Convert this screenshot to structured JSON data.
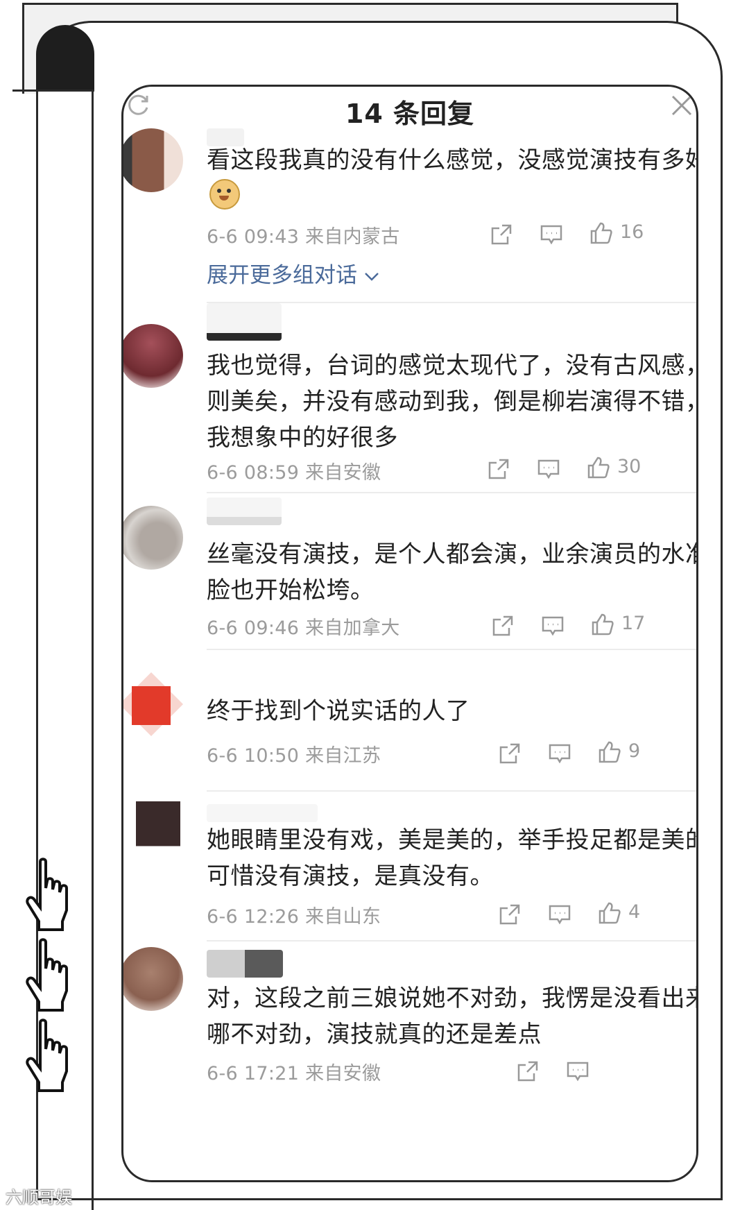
{
  "header": {
    "title": "14 条回复"
  },
  "comments": [
    {
      "text": "看这段我真的没有什么感觉，没感觉演技有多好",
      "meta": "6-6 09:43 来自内蒙古",
      "likes": "16",
      "avatar_color": "#8a5a48"
    },
    {
      "text": "我也觉得，台词的感觉太现代了，没有古风感，美则美矣，并没有感动到我，倒是柳岩演得不错，比我想象中的好很多",
      "meta": "6-6 08:59 来自安徽",
      "likes": "30",
      "avatar_color": "#6e2a30"
    },
    {
      "text": "丝毫没有演技，是个人都会演，业余演员的水准，脸也开始松垮。",
      "meta": "6-6 09:46 来自加拿大",
      "likes": "17",
      "avatar_color": "#a49c96"
    },
    {
      "text": "终于找到个说实话的人了",
      "meta": "6-6 10:50 来自江苏",
      "likes": "9",
      "avatar_color": "#e23a2a"
    },
    {
      "text": "她眼睛里没有戏，美是美的，举手投足都是美的，可惜没有演技，是真没有。",
      "meta": "6-6 12:26 来自山东",
      "likes": "4",
      "avatar_color": "#3a2a2a"
    },
    {
      "text": "对，这段之前三娘说她不对劲，我愣是没看出来她哪不对劲，演技就真的还是差点",
      "meta": "6-6 17:21 来自安徽",
      "likes": "",
      "avatar_color": "#8a6050"
    }
  ],
  "expand_link": "展开更多组对话",
  "icons": {
    "refresh": "refresh-icon",
    "close": "close-icon",
    "share": "share-icon",
    "comment": "comment-icon",
    "like": "thumbs-up-icon",
    "pointer": "pointer-hand-icon"
  },
  "watermark": "六顺哥娱"
}
